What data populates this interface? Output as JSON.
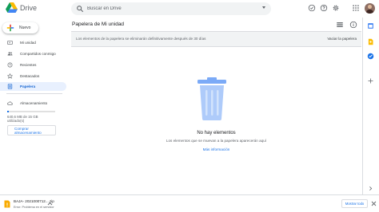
{
  "header": {
    "app_name": "Drive",
    "search_placeholder": "Buscar en Drive",
    "icons": [
      "offline-ready-icon",
      "help-icon",
      "settings-icon",
      "apps-grid-icon",
      "account-avatar"
    ]
  },
  "sidebar": {
    "new_label": "Nuevo",
    "items": [
      {
        "label": "Mi unidad",
        "icon": "my-drive-icon",
        "active": false
      },
      {
        "label": "Compartidos conmigo",
        "icon": "shared-icon",
        "active": false
      },
      {
        "label": "Recientes",
        "icon": "clock-icon",
        "active": false
      },
      {
        "label": "Destacados",
        "icon": "star-icon",
        "active": false
      },
      {
        "label": "Papelera",
        "icon": "trash-icon",
        "active": true
      },
      {
        "label": "Almacenamiento",
        "icon": "cloud-icon",
        "active": false
      }
    ],
    "storage_text": "640,6 MB de 15 GB utilizado(s)",
    "storage_used_fraction": 0.04,
    "buy_label": "Comprar almacenamiento"
  },
  "main": {
    "title": "Papelera de Mi unidad",
    "notice": "Los elementos de la papelera se eliminarán definitivamente después de 30 días",
    "empty_trash_label": "Vaciar la papelera",
    "empty_title": "No hay elementos",
    "empty_subtitle": "Los elementos que se muevan a la papelera aparecerán aquí",
    "more_info": "Más información"
  },
  "downloads": {
    "file_name": "BAJA- 2021000712....zip",
    "status": "Error: Problema en el servidor",
    "show_all_label": "Mostrar todo"
  },
  "colors": {
    "accent": "#1a73e8",
    "active_bg": "#e8f0fe",
    "trash_blue": "#aecbfa"
  }
}
